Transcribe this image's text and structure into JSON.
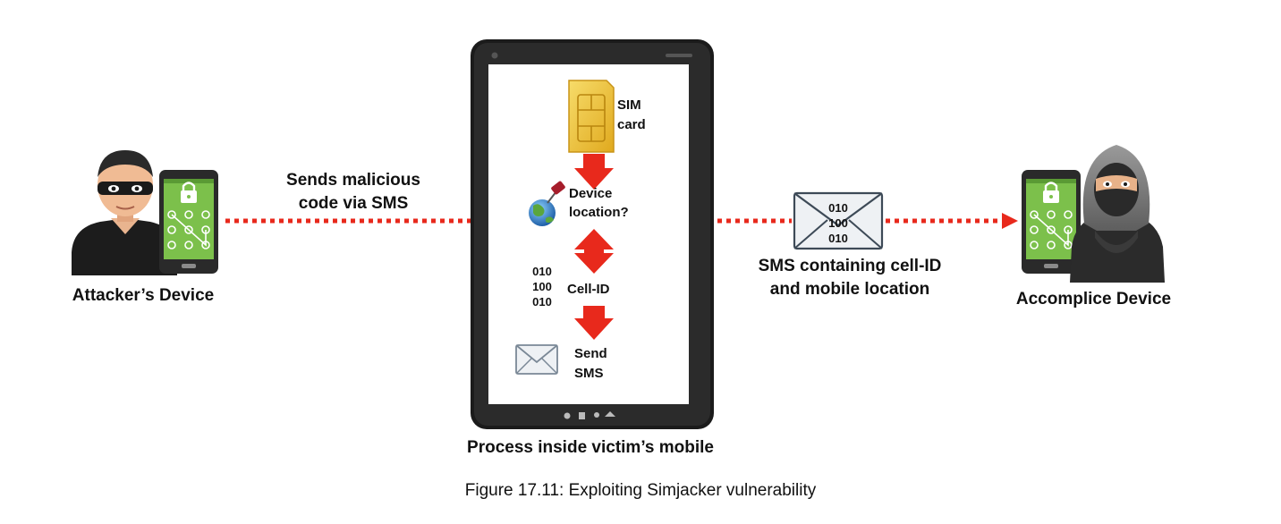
{
  "labels": {
    "attacker": "Attacker’s Device",
    "accomplice": "Accomplice Device",
    "sends_line1": "Sends malicious",
    "sends_line2": "code via SMS",
    "sms_line1": "SMS containing cell-ID",
    "sms_line2": "and mobile location",
    "process": "Process inside victim’s mobile",
    "caption": "Figure 17.11: Exploiting Simjacker vulnerability"
  },
  "phone_steps": {
    "sim_line1": "SIM",
    "sim_line2": "card",
    "location_line1": "Device",
    "location_line2": "location?",
    "cellid": "Cell-ID",
    "send_line1": "Send",
    "send_line2": "SMS",
    "binary": [
      "010",
      "100",
      "010"
    ]
  },
  "envelope_binary": [
    "010",
    "100",
    "010"
  ],
  "colors": {
    "arrow_red": "#e8291c",
    "phone_body": "#1b1b1b",
    "screen_green": "#7cc04b",
    "sim_gold": "#f2c73d",
    "envelope_fill": "#eef1f4"
  },
  "icons": [
    "attacker-icon",
    "accomplice-icon",
    "smartphone-lock-icon",
    "sim-card-icon",
    "globe-pin-icon",
    "envelope-icon"
  ]
}
